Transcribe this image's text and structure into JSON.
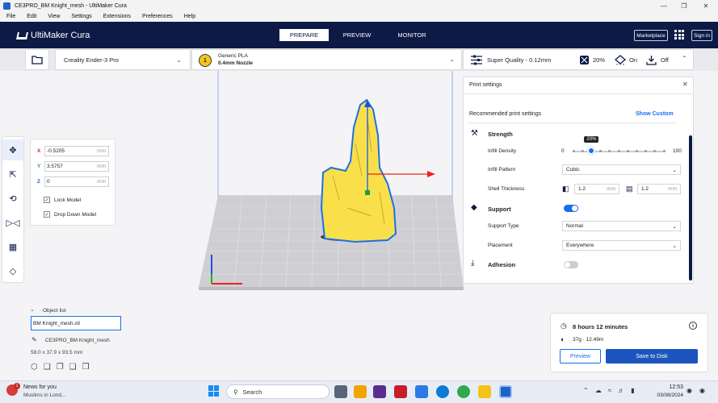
{
  "window": {
    "title": "CE3PRO_BM Knight_mesh - UltiMaker Cura"
  },
  "menu": [
    "File",
    "Edit",
    "View",
    "Settings",
    "Extensions",
    "Preferences",
    "Help"
  ],
  "header": {
    "logo": "UltiMaker Cura",
    "stages": [
      "PREPARE",
      "PREVIEW",
      "MONITOR"
    ],
    "marketplace": "Marketplace",
    "signin": "Sign in"
  },
  "machine": {
    "printer": "Creality Ender-3 Pro",
    "material": "Generic PLA",
    "nozzle": "0.4mm Nozzle",
    "extruder_num": "1"
  },
  "quick": {
    "profile": "Super Quality - 0.12mm",
    "infill": "20%",
    "support": "On",
    "adhesion": "Off"
  },
  "move": {
    "x": "-0.5205",
    "y": "3.5757",
    "z": "0",
    "unit": "mm",
    "lock": "Lock Model",
    "drop": "Drop Down Model"
  },
  "print_settings": {
    "title": "Print settings",
    "recommended": "Recommended print settings",
    "show_custom": "Show Custom",
    "strength": "Strength",
    "infill_density": "Infill Density",
    "infill_min": "0",
    "infill_max": "100",
    "infill_value": "20%",
    "infill_fraction": 0.2,
    "infill_pattern": "Infill Pattern",
    "infill_pattern_value": "Cubic",
    "shell_thickness": "Shell Thickness",
    "wall_value": "1.2",
    "topbottom_value": "1.2",
    "unit": "mm",
    "support": "Support",
    "support_type": "Support Type",
    "support_type_value": "Normal",
    "placement": "Placement",
    "placement_value": "Everywhere",
    "adhesion": "Adhesion"
  },
  "objects": {
    "header": "Object list",
    "selected": "BM Knight_mesh.stl",
    "job": "CE3PRO_BM Knight_mesh",
    "dims": "58.0 x 37.9 x 93.5 mm"
  },
  "estimate": {
    "time": "8 hours 12 minutes",
    "material": "37g · 12.49m",
    "preview": "Preview",
    "save": "Save to Disk"
  },
  "taskbar": {
    "news_title": "News for you",
    "news_sub": "Muslims in Lond...",
    "search": "Search",
    "time": "12:53",
    "date": "03/08/2024",
    "badge": "1"
  },
  "colors": {
    "header": "#0d1a45",
    "accent": "#196ef0",
    "model": "#f9e04a"
  }
}
